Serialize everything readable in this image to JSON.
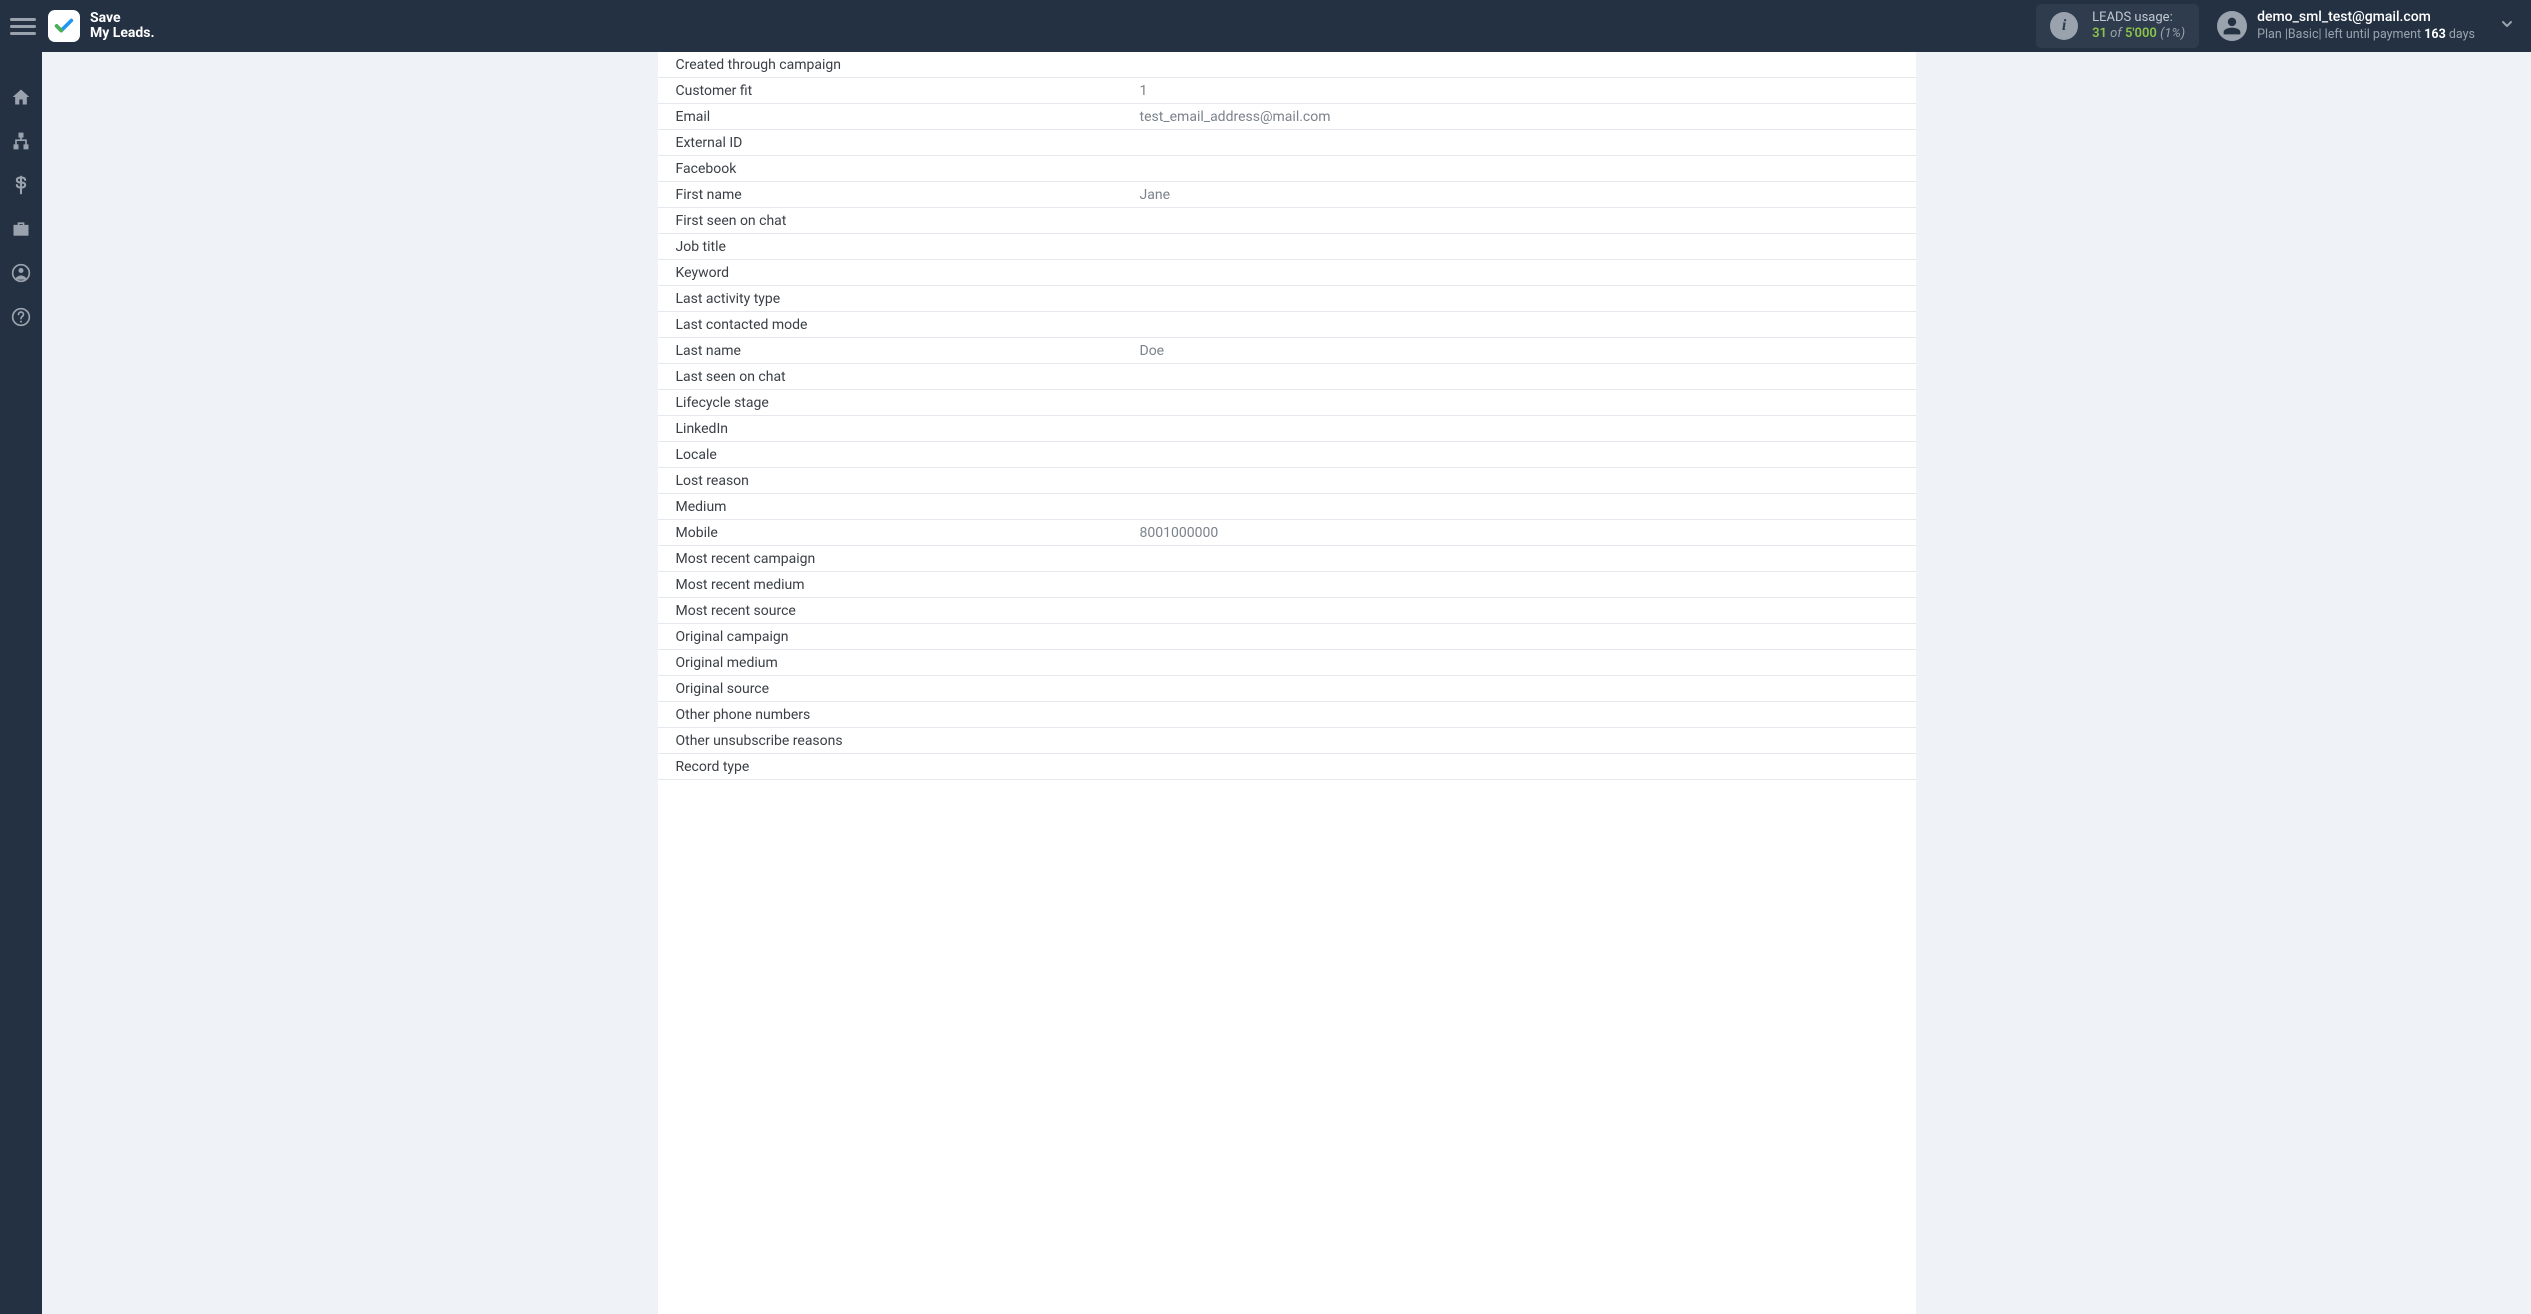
{
  "brand": {
    "line1": "Save",
    "line2": "My Leads."
  },
  "leads": {
    "label": "LEADS usage:",
    "used": "31",
    "of": "of",
    "total": "5'000",
    "pct": "(1%)"
  },
  "user": {
    "email": "demo_sml_test@gmail.com",
    "plan_prefix": "Plan |",
    "plan_name": "Basic",
    "plan_mid": "| left until payment ",
    "days": "163",
    "days_suffix": " days"
  },
  "fields": [
    {
      "label": "Created through campaign",
      "value": ""
    },
    {
      "label": "Customer fit",
      "value": "1"
    },
    {
      "label": "Email",
      "value": "test_email_address@mail.com"
    },
    {
      "label": "External ID",
      "value": ""
    },
    {
      "label": "Facebook",
      "value": ""
    },
    {
      "label": "First name",
      "value": "Jane"
    },
    {
      "label": "First seen on chat",
      "value": ""
    },
    {
      "label": "Job title",
      "value": ""
    },
    {
      "label": "Keyword",
      "value": ""
    },
    {
      "label": "Last activity type",
      "value": ""
    },
    {
      "label": "Last contacted mode",
      "value": ""
    },
    {
      "label": "Last name",
      "value": "Doe"
    },
    {
      "label": "Last seen on chat",
      "value": ""
    },
    {
      "label": "Lifecycle stage",
      "value": ""
    },
    {
      "label": "LinkedIn",
      "value": ""
    },
    {
      "label": "Locale",
      "value": ""
    },
    {
      "label": "Lost reason",
      "value": ""
    },
    {
      "label": "Medium",
      "value": ""
    },
    {
      "label": "Mobile",
      "value": "8001000000"
    },
    {
      "label": "Most recent campaign",
      "value": ""
    },
    {
      "label": "Most recent medium",
      "value": ""
    },
    {
      "label": "Most recent source",
      "value": ""
    },
    {
      "label": "Original campaign",
      "value": ""
    },
    {
      "label": "Original medium",
      "value": ""
    },
    {
      "label": "Original source",
      "value": ""
    },
    {
      "label": "Other phone numbers",
      "value": ""
    },
    {
      "label": "Other unsubscribe reasons",
      "value": ""
    },
    {
      "label": "Record type",
      "value": ""
    }
  ]
}
